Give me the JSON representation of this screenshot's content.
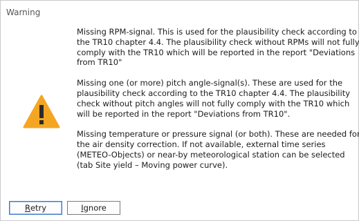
{
  "dialog": {
    "title": "Warning",
    "icon": "warning-triangle-icon",
    "icon_color": "#f4a623",
    "messages": [
      "Missing RPM-signal. This is used for the plausibility check according to the TR10 chapter 4.4. The plausibility check without RPMs will not fully comply with the TR10 which will be reported in the report \"Deviations from TR10\"",
      "Missing one (or more) pitch angle-signal(s). These are used for the plausibility check according to the TR10 chapter 4.4. The plausibility check without pitch angles will not fully comply with the TR10 which will be reported in the report \"Deviations from TR10\".",
      "Missing temperature or pressure signal (or both). These are needed for the air density correction. If not available, external time series (METEO-Objects) or near-by meteorological station can be selected (tab Site yield – Moving power curve)."
    ]
  },
  "buttons": {
    "retry": {
      "mnemonic": "R",
      "rest": "etry"
    },
    "ignore": {
      "mnemonic": "I",
      "rest": "gnore"
    }
  }
}
